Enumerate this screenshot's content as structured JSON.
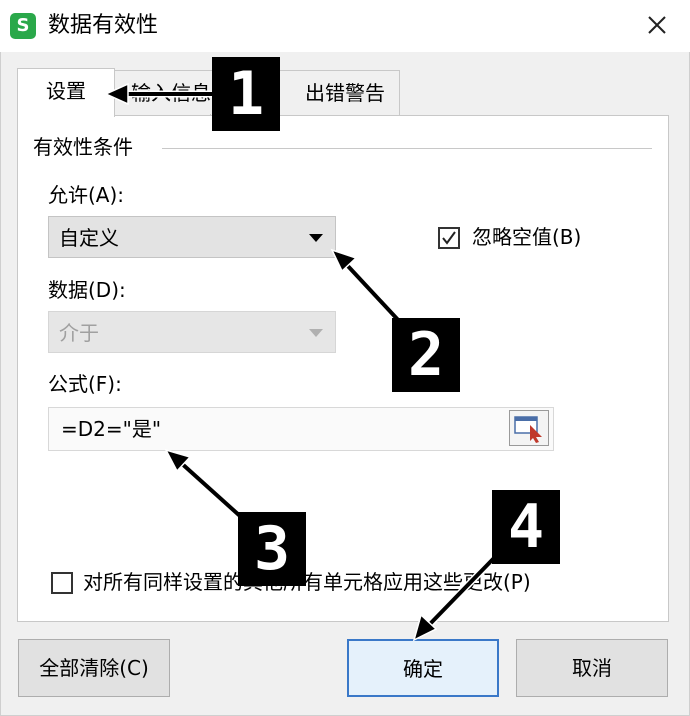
{
  "window": {
    "title": "数据有效性",
    "app_icon_letter": "S"
  },
  "tabs": [
    {
      "label": "设置",
      "active": true
    },
    {
      "label": "输入信息",
      "active": false
    },
    {
      "label": "出错警告",
      "active": false
    }
  ],
  "criteria": {
    "group_label": "有效性条件",
    "allow_label": "允许(A):",
    "allow_value": "自定义",
    "ignore_blank_label": "忽略空值(B)",
    "ignore_blank_checked": true,
    "data_label": "数据(D):",
    "data_value": "介于",
    "data_disabled": true,
    "formula_label": "公式(F):",
    "formula_value": "=D2=\"是\""
  },
  "apply_all": {
    "label": "对所有同样设置的其他所有单元格应用这些更改(P)",
    "checked": false
  },
  "buttons": {
    "clear_all": "全部清除(C)",
    "ok": "确定",
    "cancel": "取消"
  },
  "annotations": [
    "1",
    "2",
    "3",
    "4"
  ],
  "colors": {
    "accent_border": "#3a78c8",
    "app_icon": "#2aa84a",
    "annotation": "#000000"
  }
}
